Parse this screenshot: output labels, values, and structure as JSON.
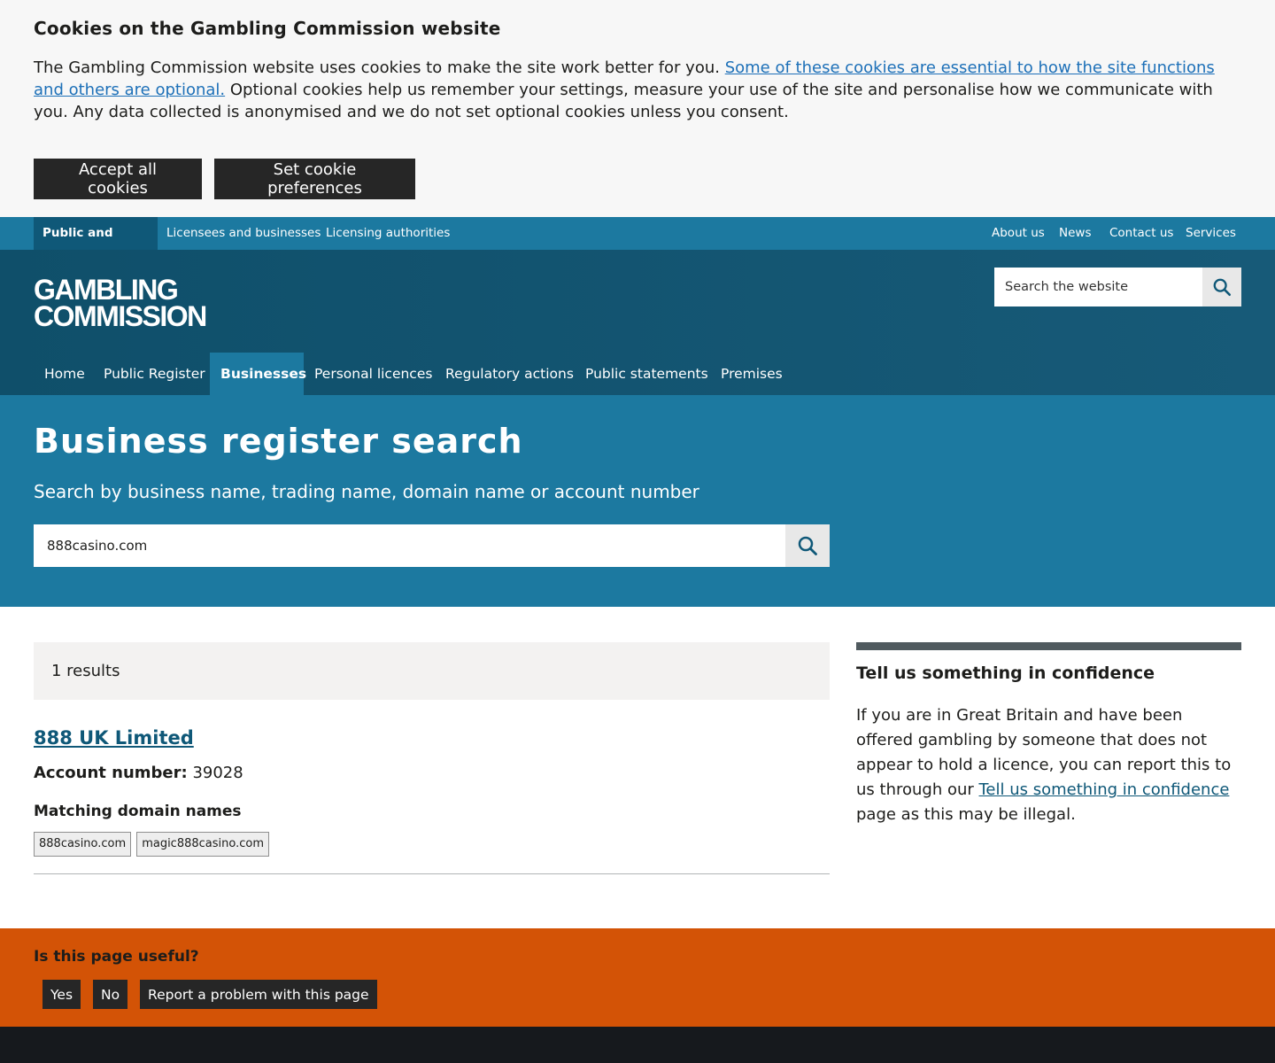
{
  "cookie": {
    "title": "Cookies on the Gambling Commission website",
    "text_before": "The Gambling Commission website uses cookies to make the site work better for you. ",
    "link": "Some of these cookies are essential to how the site functions and others are optional.",
    "text_after": " Optional cookies help us remember your settings, measure your use of the site and personalise how we communicate with you. Any data collected is anonymised and we do not set optional cookies unless you consent.",
    "accept_label": "Accept all cookies",
    "prefs_label": "Set cookie preferences"
  },
  "topnav": {
    "left": [
      "Public and players",
      "Licensees and businesses",
      "Licensing authorities"
    ],
    "right": [
      "About us",
      "News",
      "Contact us",
      "Services"
    ]
  },
  "header": {
    "logo_line1": "GAMBLING",
    "logo_line2": "COMMISSION",
    "search_placeholder": "Search the website"
  },
  "mainnav": [
    "Home",
    "Public Register",
    "Businesses",
    "Personal licences",
    "Regulatory actions",
    "Public statements",
    "Premises"
  ],
  "hero": {
    "title": "Business register search",
    "subtitle": "Search by business name, trading name, domain name or account number",
    "search_value": "888casino.com"
  },
  "results": {
    "count": "1 results",
    "title": "888 UK Limited",
    "account_label": "Account number:",
    "account_value": "39028",
    "domains_heading": "Matching domain names",
    "domains": [
      "888casino.com",
      "magic888casino.com"
    ]
  },
  "sidebar": {
    "title": "Tell us something in confidence",
    "text_before": "If you are in Great Britain and have been offered gambling by someone that does not appear to hold a licence, you can report this to us through our ",
    "link": "Tell us something in confidence",
    "text_after": " page as this may be illegal."
  },
  "feedback": {
    "question": "Is this page useful?",
    "yes": "Yes",
    "no": "No",
    "report": "Report a problem with this page"
  }
}
